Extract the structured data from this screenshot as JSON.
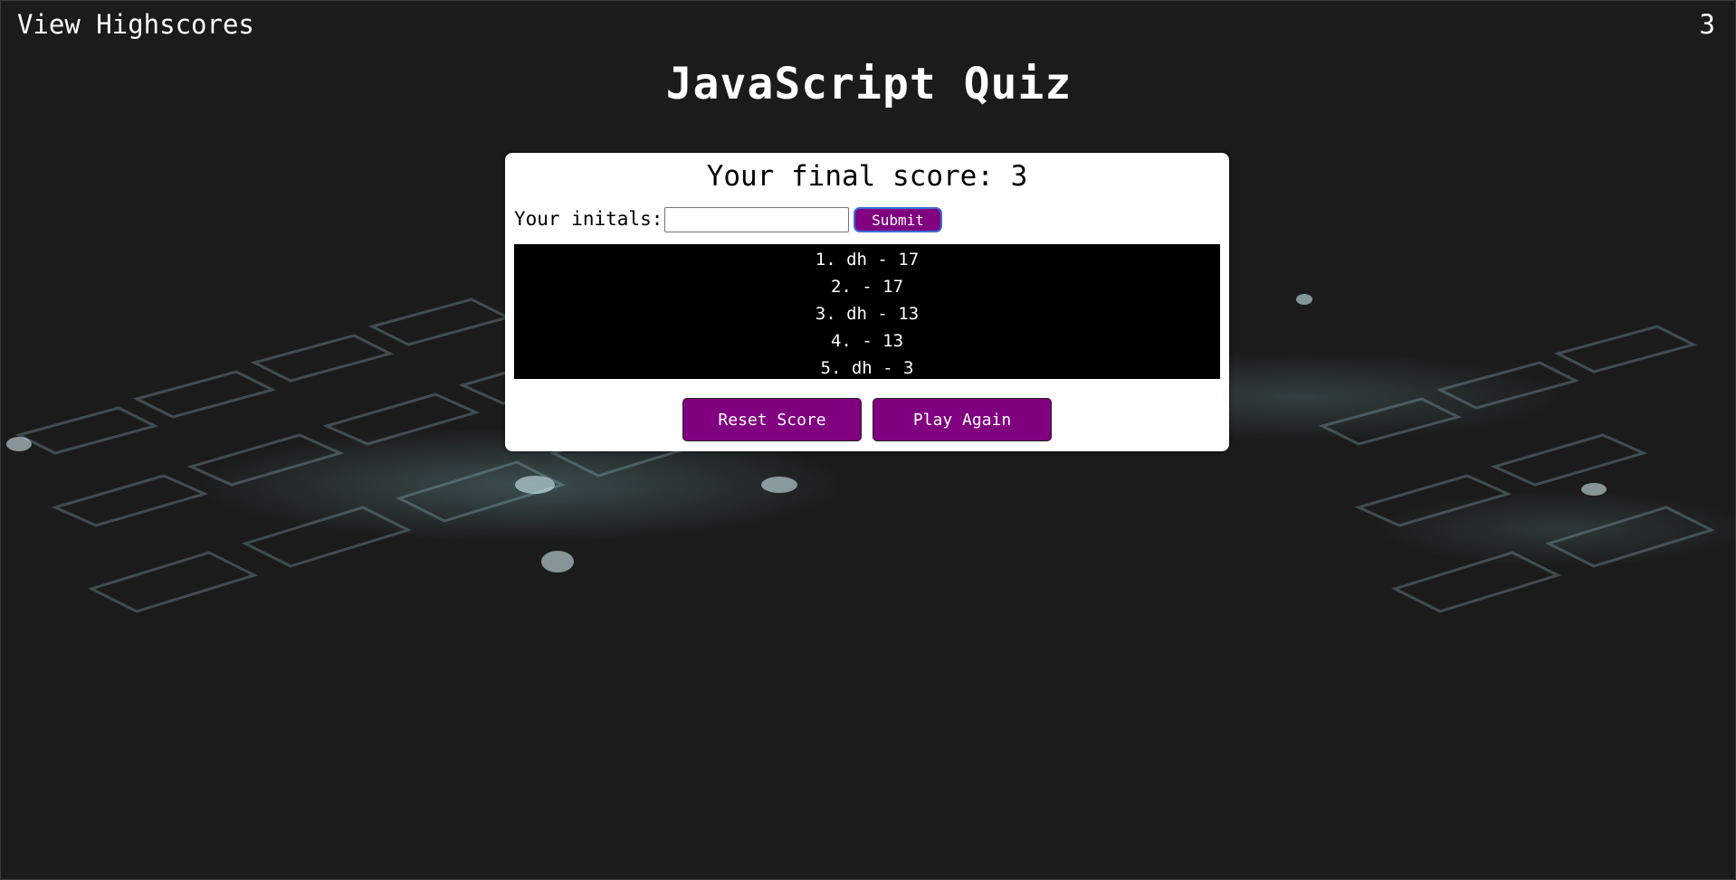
{
  "header": {
    "highscores_link": "View Highscores",
    "timer": "3"
  },
  "title": "JavaScript Quiz",
  "card": {
    "final_score_text": "Your final score: 3",
    "initials_label": "Your initals:",
    "initials_value": "",
    "submit_label": "Submit",
    "scores": [
      "1. dh - 17",
      "2. - 17",
      "3. dh - 13",
      "4. - 13",
      "5. dh - 3"
    ],
    "reset_label": "Reset Score",
    "play_again_label": "Play Again"
  },
  "colors": {
    "accent": "#800080",
    "background": "#1b1b1b",
    "card": "#ffffff",
    "scores_bg": "#000000"
  }
}
